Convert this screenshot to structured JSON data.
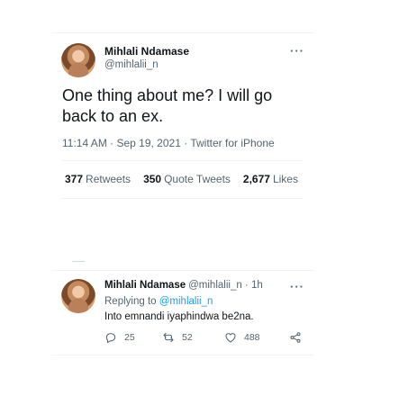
{
  "main_tweet": {
    "author_name": "Mihlali Ndamase",
    "handle": "@mihlalii_n",
    "text": "One thing about me? I will go back to an ex.",
    "meta": "11:14 AM · Sep 19, 2021 · Twitter for iPhone",
    "stats": [
      {
        "count": "377",
        "label": "Retweets"
      },
      {
        "count": "350",
        "label": "Quote Tweets"
      },
      {
        "count": "2,677",
        "label": "Likes"
      }
    ],
    "more_label": "···"
  },
  "reply_tweet": {
    "author_name": "Mihlali Ndamase",
    "handle_time": "@mihlalii_n · 1h",
    "replying_prefix": "Replying to",
    "replying_to": "@mihlalii_n",
    "text": "Into emnandi iyaphindwa be2na.",
    "more_label": "···",
    "actions": {
      "reply_count": "25",
      "retweet_count": "52",
      "like_count": "488"
    }
  },
  "colors": {
    "text_primary": "#0f1419",
    "text_secondary": "#536471",
    "link": "#1d9bf0",
    "divider": "#eff3f4"
  },
  "icons": [
    "more-icon",
    "reply-icon",
    "retweet-icon",
    "like-icon",
    "share-icon"
  ]
}
